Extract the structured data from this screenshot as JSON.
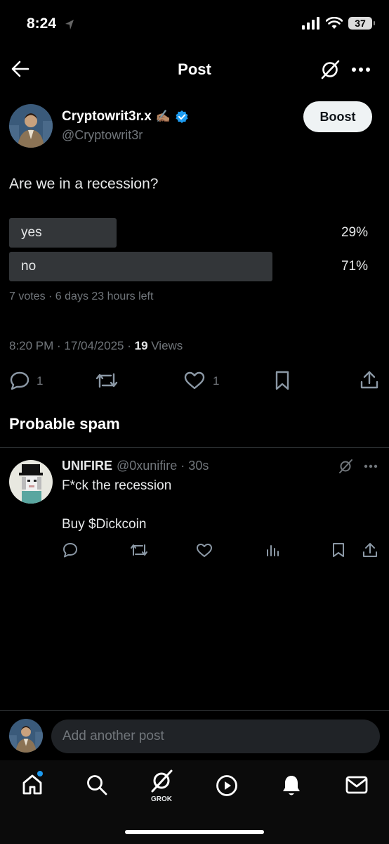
{
  "status": {
    "time": "8:24",
    "battery": "37"
  },
  "header": {
    "title": "Post"
  },
  "post": {
    "author_name": "Cryptowrit3r.x",
    "author_emoji": "✍🏽",
    "author_handle": "@Cryptowrit3r",
    "boost_label": "Boost",
    "text": "Are we in a recession?",
    "poll": {
      "options": [
        {
          "label": "yes",
          "percent": "29%",
          "fraction": 0.29
        },
        {
          "label": "no",
          "percent": "71%",
          "fraction": 0.71
        }
      ],
      "meta": "7 votes · 6 days 23 hours left"
    },
    "timestamp": "8:20 PM · 17/04/2025 · ",
    "views_count": "19",
    "views_label": " Views",
    "actions": {
      "replies": "1",
      "likes": "1"
    }
  },
  "section": {
    "title": "Probable spam"
  },
  "reply": {
    "name": "UNIFIRE",
    "handle": "@0xunifire · 30s",
    "line1": "F*ck the recession",
    "line2": "Buy $Dickcoin"
  },
  "compose": {
    "placeholder": "Add another post"
  },
  "tabbar": {
    "grok_label": "GROK"
  },
  "colors": {
    "accent": "#1d9bf0",
    "background": "#000000",
    "muted": "#71767b"
  }
}
